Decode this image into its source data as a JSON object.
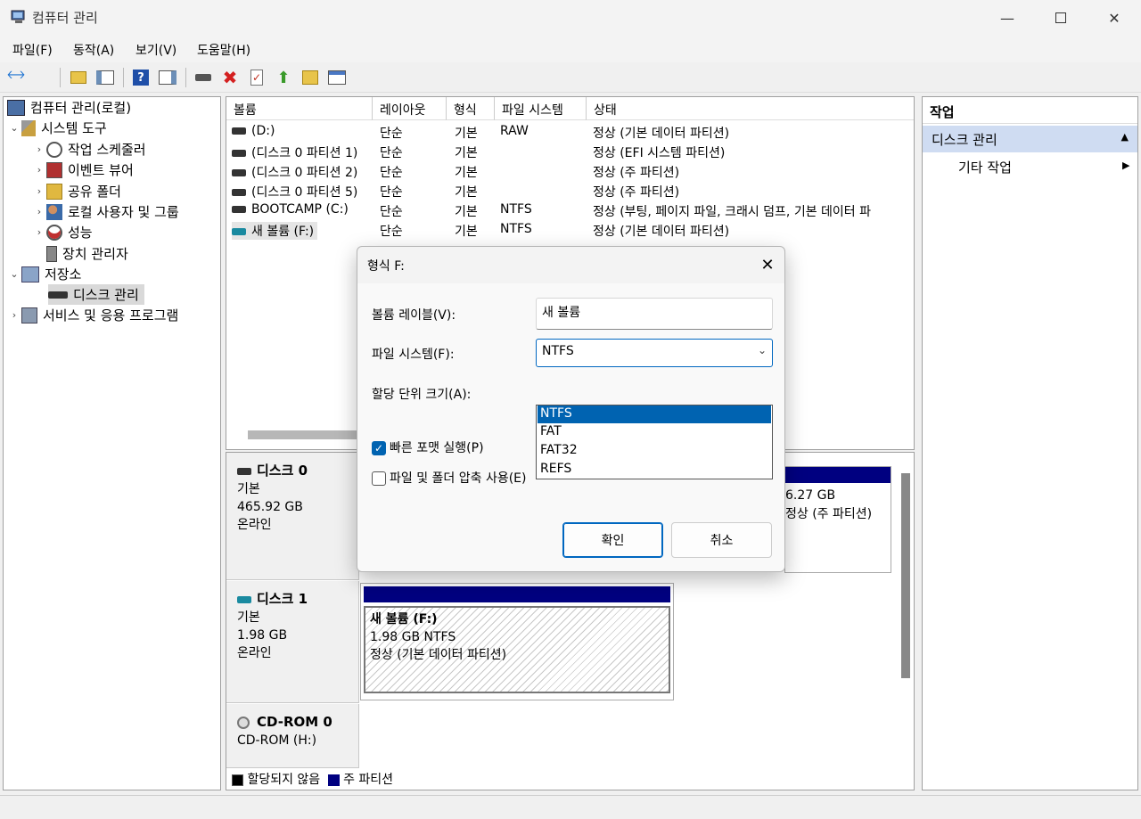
{
  "window": {
    "title": "컴퓨터 관리"
  },
  "menu": [
    "파일(F)",
    "동작(A)",
    "보기(V)",
    "도움말(H)"
  ],
  "tree": {
    "root": "컴퓨터 관리(로컬)",
    "system_tools": "시스템 도구",
    "task_scheduler": "작업 스케줄러",
    "event_viewer": "이벤트 뷰어",
    "shared_folders": "공유 폴더",
    "local_users": "로컬 사용자 및 그룹",
    "performance": "성능",
    "device_manager": "장치 관리자",
    "storage": "저장소",
    "disk_management": "디스크 관리",
    "services": "서비스 및 응용 프로그램"
  },
  "list": {
    "headers": [
      "볼륨",
      "레이아웃",
      "형식",
      "파일 시스템",
      "상태"
    ],
    "rows": [
      [
        "(D:)",
        "단순",
        "기본",
        "RAW",
        "정상 (기본 데이터 파티션)"
      ],
      [
        "(디스크 0 파티션 1)",
        "단순",
        "기본",
        "",
        "정상 (EFI 시스템 파티션)"
      ],
      [
        "(디스크 0 파티션 2)",
        "단순",
        "기본",
        "",
        "정상 (주 파티션)"
      ],
      [
        "(디스크 0 파티션 5)",
        "단순",
        "기본",
        "",
        "정상 (주 파티션)"
      ],
      [
        "BOOTCAMP (C:)",
        "단순",
        "기본",
        "NTFS",
        "정상 (부팅, 페이지 파일, 크래시 덤프, 기본 데이터 파"
      ],
      [
        "새 볼륨 (F:)",
        "단순",
        "기본",
        "NTFS",
        "정상 (기본 데이터 파티션)"
      ]
    ]
  },
  "disks": {
    "disk0": {
      "name": "디스크 0",
      "type": "기본",
      "size": "465.92 GB",
      "status": "온라인",
      "partial_size": "6.27 GB",
      "partial_status": "정상 (주 파티션)"
    },
    "disk1": {
      "name": "디스크 1",
      "type": "기본",
      "size": "1.98 GB",
      "status": "온라인",
      "vol_name": "새 볼륨  (F:)",
      "vol_size": "1.98 GB NTFS",
      "vol_status": "정상 (기본 데이터 파티션)"
    },
    "cdrom": {
      "name": "CD-ROM 0",
      "drive": "CD-ROM (H:)"
    },
    "legend": {
      "unallocated": "할당되지 않음",
      "primary": "주 파티션"
    }
  },
  "actions": {
    "header": "작업",
    "section": "디스크 관리",
    "more": "기타 작업"
  },
  "dialog": {
    "title": "형식 F:",
    "volume_label": "볼륨 레이블(V):",
    "volume_value": "새 볼륨",
    "fs_label": "파일 시스템(F):",
    "fs_value": "NTFS",
    "fs_options": [
      "NTFS",
      "FAT",
      "FAT32",
      "REFS"
    ],
    "alloc_label": "할당 단위 크기(A):",
    "quick_format": "빠른 포맷 실행(P)",
    "compress": "파일 및 폴더 압축 사용(E)",
    "ok": "확인",
    "cancel": "취소"
  },
  "colors": {
    "primary_partition": "#000080",
    "selection": "#0063b1"
  }
}
